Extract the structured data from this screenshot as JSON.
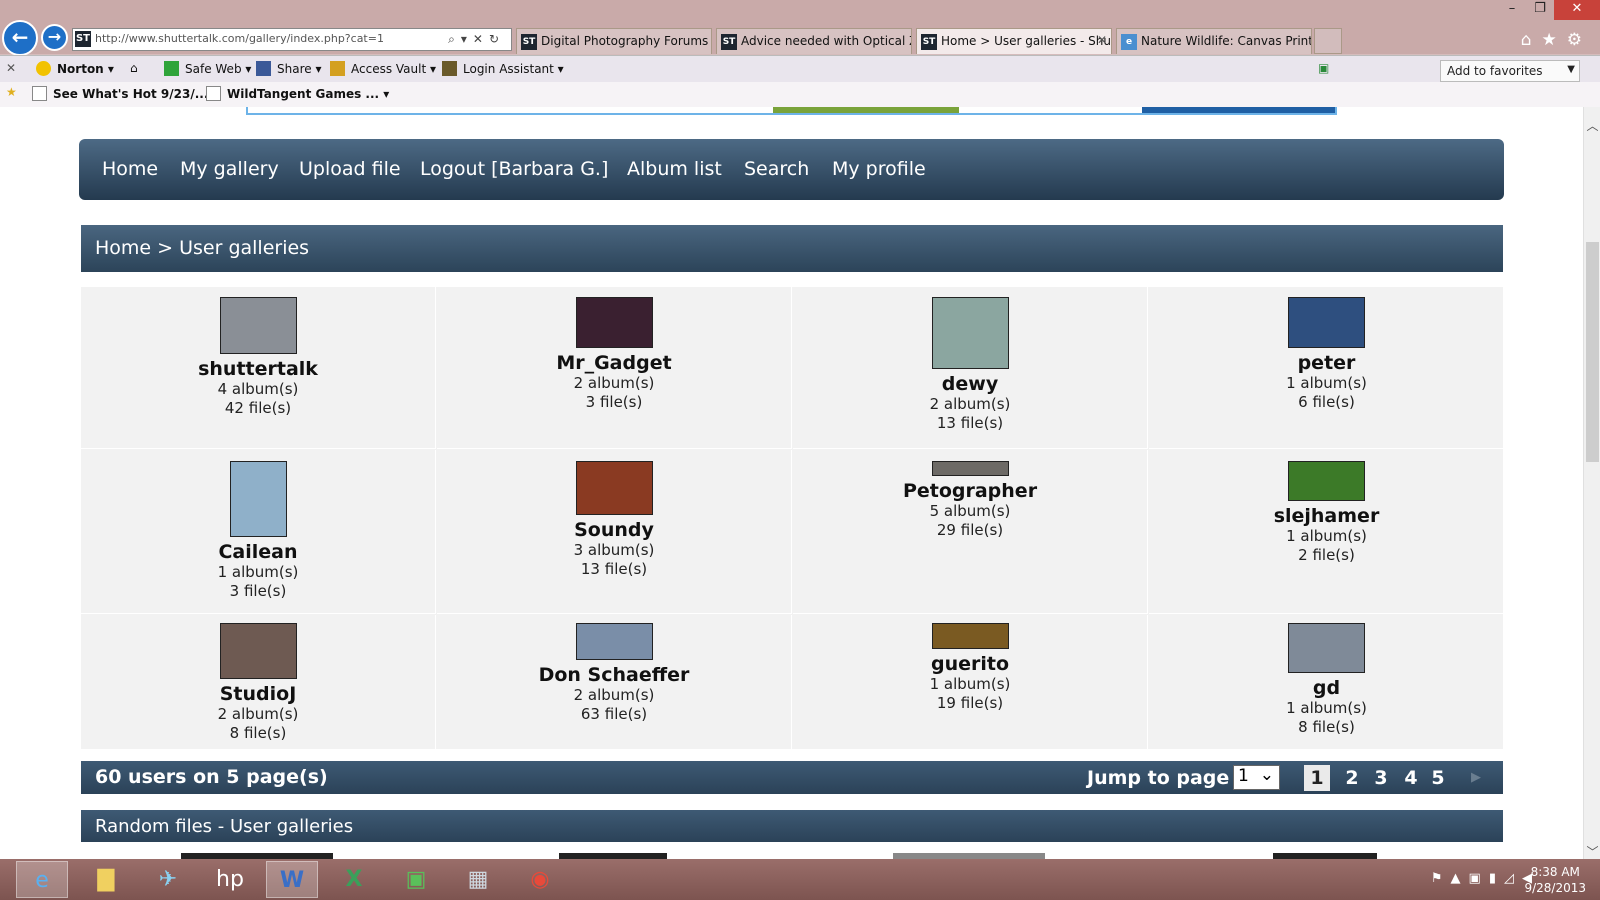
{
  "browser": {
    "url": "http://www.shuttertalk.com/gallery/index.php?cat=1",
    "tabs": [
      {
        "label": "Digital Photography Forums - ...",
        "active": false
      },
      {
        "label": "Advice needed with Optical Zo...",
        "active": false
      },
      {
        "label": "Home > User galleries - Shu...",
        "active": true
      },
      {
        "label": "Nature Wildlife: Canvas Prints |...",
        "active": false
      }
    ],
    "toolbar": {
      "norton": "Norton",
      "safe_web": "Safe Web",
      "share": "Share",
      "access_vault": "Access Vault",
      "login_assistant": "Login Assistant",
      "add_favorites": "Add to favorites"
    },
    "favorites": [
      {
        "label": "See What's Hot 9/23/..."
      },
      {
        "label": "WildTangent Games ..."
      }
    ]
  },
  "nav": {
    "items": [
      "Home",
      "My gallery",
      "Upload file",
      "Logout [Barbara G.]",
      "Album list",
      "Search",
      "My profile"
    ]
  },
  "breadcrumb": "Home > User galleries",
  "users": [
    {
      "name": "shuttertalk",
      "albums": "4 album(s)",
      "files": "42 file(s)",
      "thumb_color": "#8a8f96"
    },
    {
      "name": "Mr_Gadget",
      "albums": "2 album(s)",
      "files": "3 file(s)",
      "thumb_color": "#3a2030"
    },
    {
      "name": "dewy",
      "albums": "2 album(s)",
      "files": "13 file(s)",
      "thumb_color": "#8ba6a0"
    },
    {
      "name": "peter",
      "albums": "1 album(s)",
      "files": "6 file(s)",
      "thumb_color": "#2e4f7f"
    },
    {
      "name": "Cailean",
      "albums": "1 album(s)",
      "files": "3 file(s)",
      "thumb_color": "#8fb0c9"
    },
    {
      "name": "Soundy",
      "albums": "3 album(s)",
      "files": "13 file(s)",
      "thumb_color": "#8a3a22"
    },
    {
      "name": "Petographer",
      "albums": "5 album(s)",
      "files": "29 file(s)",
      "thumb_color": "#6d6a66"
    },
    {
      "name": "slejhamer",
      "albums": "1 album(s)",
      "files": "2 file(s)",
      "thumb_color": "#3c7a28"
    },
    {
      "name": "StudioJ",
      "albums": "2 album(s)",
      "files": "8 file(s)",
      "thumb_color": "#6e5a52"
    },
    {
      "name": "Don Schaeffer",
      "albums": "2 album(s)",
      "files": "63 file(s)",
      "thumb_color": "#7a8ea8"
    },
    {
      "name": "guerito",
      "albums": "1 album(s)",
      "files": "19 file(s)",
      "thumb_color": "#7a5a22"
    },
    {
      "name": "gd",
      "albums": "1 album(s)",
      "files": "8 file(s)",
      "thumb_color": "#7f8a98"
    }
  ],
  "pager": {
    "summary": "60 users on 5 page(s)",
    "jump_label": "Jump to page",
    "selected": "1",
    "pages": [
      "1",
      "2",
      "3",
      "4",
      "5"
    ]
  },
  "random_files": {
    "title": "Random files - User galleries"
  },
  "taskbar": {
    "time": "8:38 AM",
    "date": "9/28/2013"
  },
  "colors": {
    "nav_bar": "#2f4a62",
    "cell_bg": "#f2f2f2",
    "accent_blue": "#1e6fc7"
  }
}
